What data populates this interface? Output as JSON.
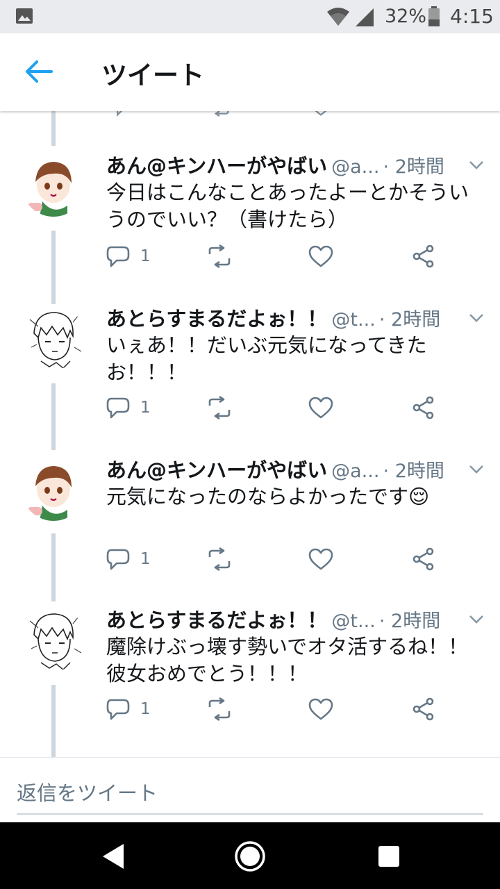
{
  "status_bar": {
    "battery": "32%",
    "time": "4:15"
  },
  "header": {
    "title": "ツイート"
  },
  "tweets": [
    {
      "name": "あん@キンハーがやばい",
      "handle": "@a...",
      "time": "· 2時間",
      "text": "今日はこんなことあったよーとかそういうのでいい？（書けたら）",
      "reply_count": "1"
    },
    {
      "name": "あとらすまるだよぉ！！",
      "handle": "@t...",
      "time": "· 2時間",
      "text": "いぇあ！！だいぶ元気になってきたお！！！",
      "reply_count": "1"
    },
    {
      "name": "あん@キンハーがやばい",
      "handle": "@a...",
      "time": "· 2時間",
      "text": "元気になったのならよかったです😌",
      "reply_count": "1"
    },
    {
      "name": "あとらすまるだよぉ！！",
      "handle": "@t...",
      "time": "· 2時間",
      "text": "魔除けぶっ壊す勢いでオタ活するね！！彼女おめでとう！！！",
      "reply_count": "1"
    }
  ],
  "reply_box": {
    "placeholder": "返信をツイート"
  },
  "colors": {
    "accent": "#1da1f2",
    "icon_gray": "#657786",
    "thread_line": "#ccd6dd"
  }
}
